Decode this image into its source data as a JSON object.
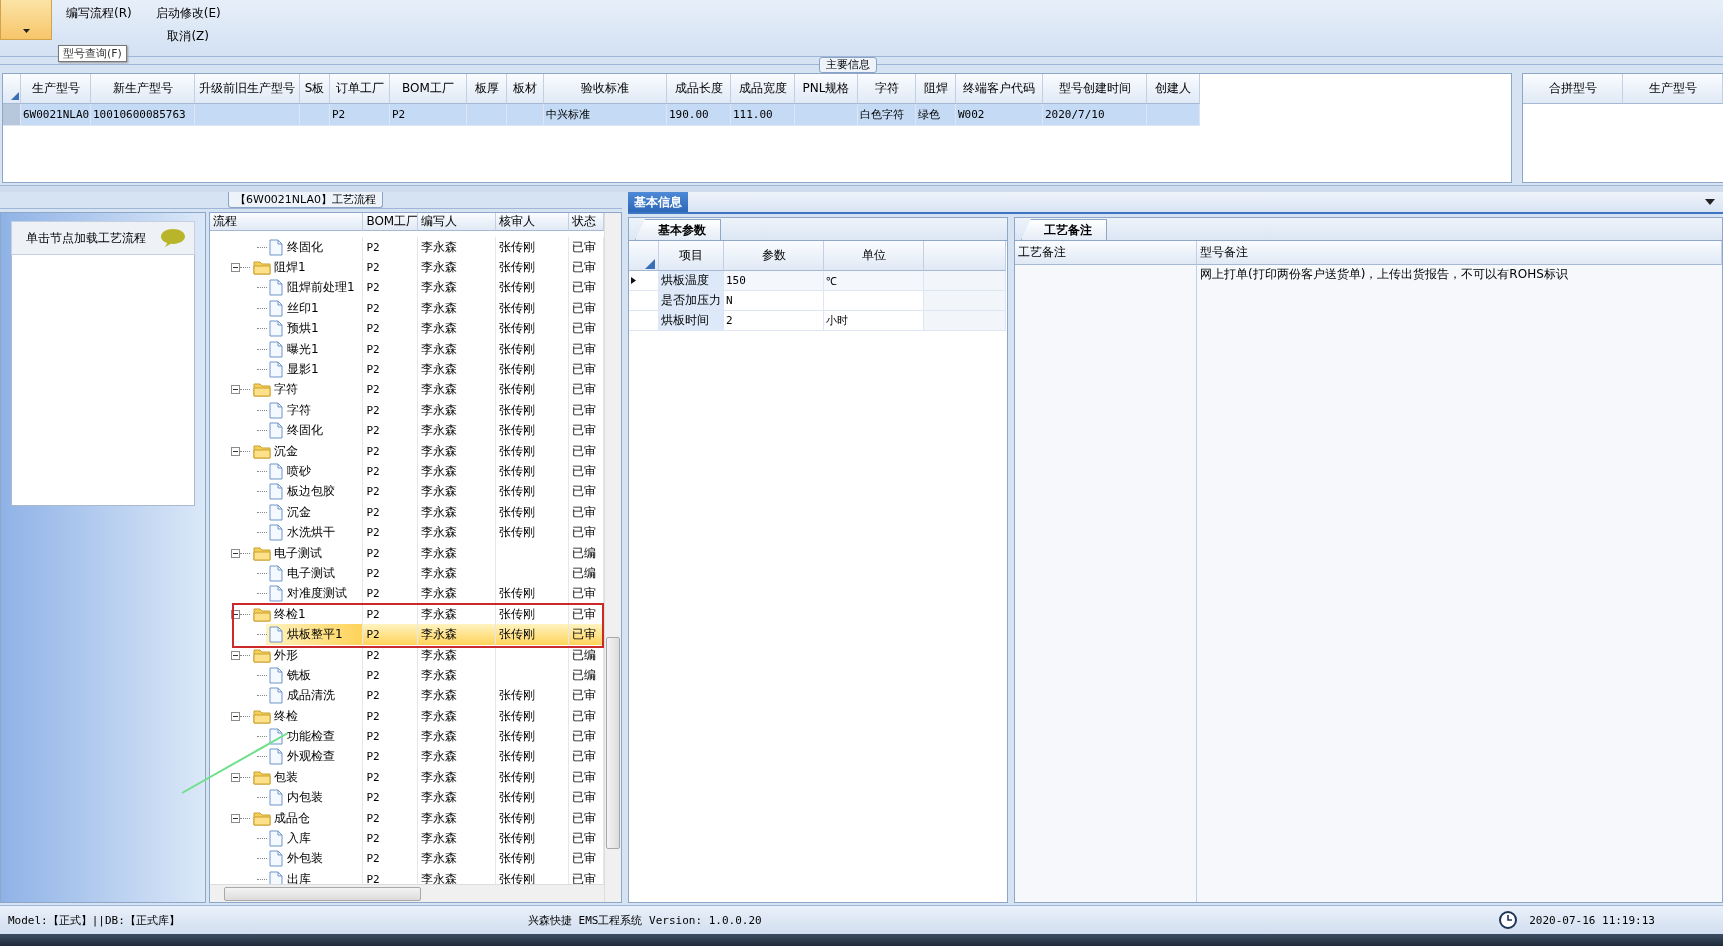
{
  "ribbon": {
    "buttons": [
      {
        "label": "编写流程(R)"
      },
      {
        "label": "启动修改(E)"
      },
      {
        "label": "取消(Z)"
      }
    ],
    "tooltip": "型号查询(F)"
  },
  "main_info": {
    "title": "主要信息",
    "columns": [
      "生产型号",
      "新生产型号",
      "升级前旧生产型号",
      "S板",
      "订单工厂",
      "BOM工厂",
      "板厚",
      "板材",
      "验收标准",
      "成品长度",
      "成品宽度",
      "PNL规格",
      "字符",
      "阻焊",
      "终端客户代码",
      "型号创建时间",
      "创建人"
    ],
    "rows": [
      {
        "selected": true,
        "cells": [
          "6W0021NLA0",
          "10010600085763",
          null,
          null,
          "P2",
          "P2",
          null,
          null,
          "中兴标准",
          "190.00",
          "111.00",
          null,
          "白色字符",
          "绿色",
          "W002",
          "2020/7/10",
          null
        ]
      }
    ],
    "side_columns": [
      "合拼型号",
      "生产型号"
    ]
  },
  "flow_panel": {
    "title": "【6W0021NLA0】工艺流程",
    "hint": "单击节点加载工艺流程",
    "columns": [
      "流程",
      "BOM工厂",
      "编写人",
      "核审人",
      "状态"
    ],
    "continued": [
      {
        "name": "终固化",
        "bom": "P2",
        "writer": "李永森",
        "reviewer": "张传刚",
        "status": "已审",
        "selected": false
      }
    ],
    "nodes": [
      {
        "name": "阻焊1",
        "bom": "P2",
        "writer": "李永森",
        "reviewer": "张传刚",
        "status": "已审",
        "selected": false,
        "expanded": true,
        "children": [
          {
            "name": "阻焊前处理1",
            "bom": "P2",
            "writer": "李永森",
            "reviewer": "张传刚",
            "status": "已审",
            "selected": false
          },
          {
            "name": "丝印1",
            "bom": "P2",
            "writer": "李永森",
            "reviewer": "张传刚",
            "status": "已审",
            "selected": false
          },
          {
            "name": "预烘1",
            "bom": "P2",
            "writer": "李永森",
            "reviewer": "张传刚",
            "status": "已审",
            "selected": false
          },
          {
            "name": "曝光1",
            "bom": "P2",
            "writer": "李永森",
            "reviewer": "张传刚",
            "status": "已审",
            "selected": false
          },
          {
            "name": "显影1",
            "bom": "P2",
            "writer": "李永森",
            "reviewer": "张传刚",
            "status": "已审",
            "selected": false
          }
        ]
      },
      {
        "name": "字符",
        "bom": "P2",
        "writer": "李永森",
        "reviewer": "张传刚",
        "status": "已审",
        "selected": false,
        "expanded": true,
        "children": [
          {
            "name": "字符",
            "bom": "P2",
            "writer": "李永森",
            "reviewer": "张传刚",
            "status": "已审",
            "selected": false
          },
          {
            "name": "终固化",
            "bom": "P2",
            "writer": "李永森",
            "reviewer": "张传刚",
            "status": "已审",
            "selected": false
          }
        ]
      },
      {
        "name": "沉金",
        "bom": "P2",
        "writer": "李永森",
        "reviewer": "张传刚",
        "status": "已审",
        "selected": false,
        "expanded": true,
        "children": [
          {
            "name": "喷砂",
            "bom": "P2",
            "writer": "李永森",
            "reviewer": "张传刚",
            "status": "已审",
            "selected": false
          },
          {
            "name": "板边包胶",
            "bom": "P2",
            "writer": "李永森",
            "reviewer": "张传刚",
            "status": "已审",
            "selected": false
          },
          {
            "name": "沉金",
            "bom": "P2",
            "writer": "李永森",
            "reviewer": "张传刚",
            "status": "已审",
            "selected": false
          },
          {
            "name": "水洗烘干",
            "bom": "P2",
            "writer": "李永森",
            "reviewer": "张传刚",
            "status": "已审",
            "selected": false
          }
        ]
      },
      {
        "name": "电子测试",
        "bom": "P2",
        "writer": "李永森",
        "status": "已编",
        "selected": false,
        "expanded": true,
        "children": [
          {
            "name": "电子测试",
            "bom": "P2",
            "writer": "李永森",
            "status": "已编",
            "selected": false
          },
          {
            "name": "对准度测试",
            "bom": "P2",
            "writer": "李永森",
            "reviewer": "张传刚",
            "status": "已审",
            "selected": false
          }
        ]
      },
      {
        "name": "终检1",
        "bom": "P2",
        "writer": "李永森",
        "reviewer": "张传刚",
        "status": "已审",
        "selected": false,
        "expanded": true,
        "children": [
          {
            "name": "烘板整平1",
            "bom": "P2",
            "writer": "李永森",
            "reviewer": "张传刚",
            "status": "已审",
            "selected": true
          }
        ]
      },
      {
        "name": "外形",
        "bom": "P2",
        "writer": "李永森",
        "status": "已编",
        "selected": false,
        "expanded": true,
        "children": [
          {
            "name": "铣板",
            "bom": "P2",
            "writer": "李永森",
            "status": "已编",
            "selected": false
          },
          {
            "name": "成品清洗",
            "bom": "P2",
            "writer": "李永森",
            "reviewer": "张传刚",
            "status": "已审",
            "selected": false
          }
        ]
      },
      {
        "name": "终检",
        "bom": "P2",
        "writer": "李永森",
        "reviewer": "张传刚",
        "status": "已审",
        "selected": false,
        "expanded": true,
        "children": [
          {
            "name": "功能检查",
            "bom": "P2",
            "writer": "李永森",
            "reviewer": "张传刚",
            "status": "已审",
            "selected": false
          },
          {
            "name": "外观检查",
            "bom": "P2",
            "writer": "李永森",
            "reviewer": "张传刚",
            "status": "已审",
            "selected": false
          }
        ]
      },
      {
        "name": "包装",
        "bom": "P2",
        "writer": "李永森",
        "reviewer": "张传刚",
        "status": "已审",
        "selected": false,
        "expanded": true,
        "children": [
          {
            "name": "内包装",
            "bom": "P2",
            "writer": "李永森",
            "reviewer": "张传刚",
            "status": "已审",
            "selected": false
          }
        ]
      },
      {
        "name": "成品仓",
        "bom": "P2",
        "writer": "李永森",
        "reviewer": "张传刚",
        "status": "已审",
        "selected": false,
        "expanded": true,
        "children": [
          {
            "name": "入库",
            "bom": "P2",
            "writer": "李永森",
            "reviewer": "张传刚",
            "status": "已审",
            "selected": false
          },
          {
            "name": "外包装",
            "bom": "P2",
            "writer": "李永森",
            "reviewer": "张传刚",
            "status": "已审",
            "selected": false
          },
          {
            "name": "出库",
            "bom": "P2",
            "writer": "李永森",
            "reviewer": "张传刚",
            "status": "已审",
            "selected": false
          }
        ]
      }
    ]
  },
  "basic_info": {
    "tab": "基本信息",
    "params_tab": "基本参数",
    "columns": [
      "项目",
      "参数",
      "单位"
    ],
    "rows": [
      {
        "item": "烘板温度",
        "value": "150",
        "unit": "℃",
        "selected": true
      },
      {
        "item": "是否加压力",
        "value": "N",
        "selected": false
      },
      {
        "item": "烘板时间",
        "value": "2",
        "unit": "小时",
        "selected": false
      }
    ]
  },
  "notes": {
    "tab": "工艺备注",
    "columns": [
      "工艺备注",
      "型号备注"
    ],
    "rows": [
      {
        "model_note": "网上打单(打印两份客户送货单)，上传出货报告，不可以有ROHS标识"
      }
    ]
  },
  "annotations": [
    {
      "kind": "frame",
      "color": "#cc2a2a"
    },
    {
      "kind": "stroke",
      "color": "#6ee08a"
    }
  ],
  "status_bar": {
    "left": "Model:【正式】||DB:【正式库】",
    "center": "兴森快捷 EMS工程系统 Version: 1.0.0.20",
    "time": "2020-07-16 11:19:13"
  }
}
